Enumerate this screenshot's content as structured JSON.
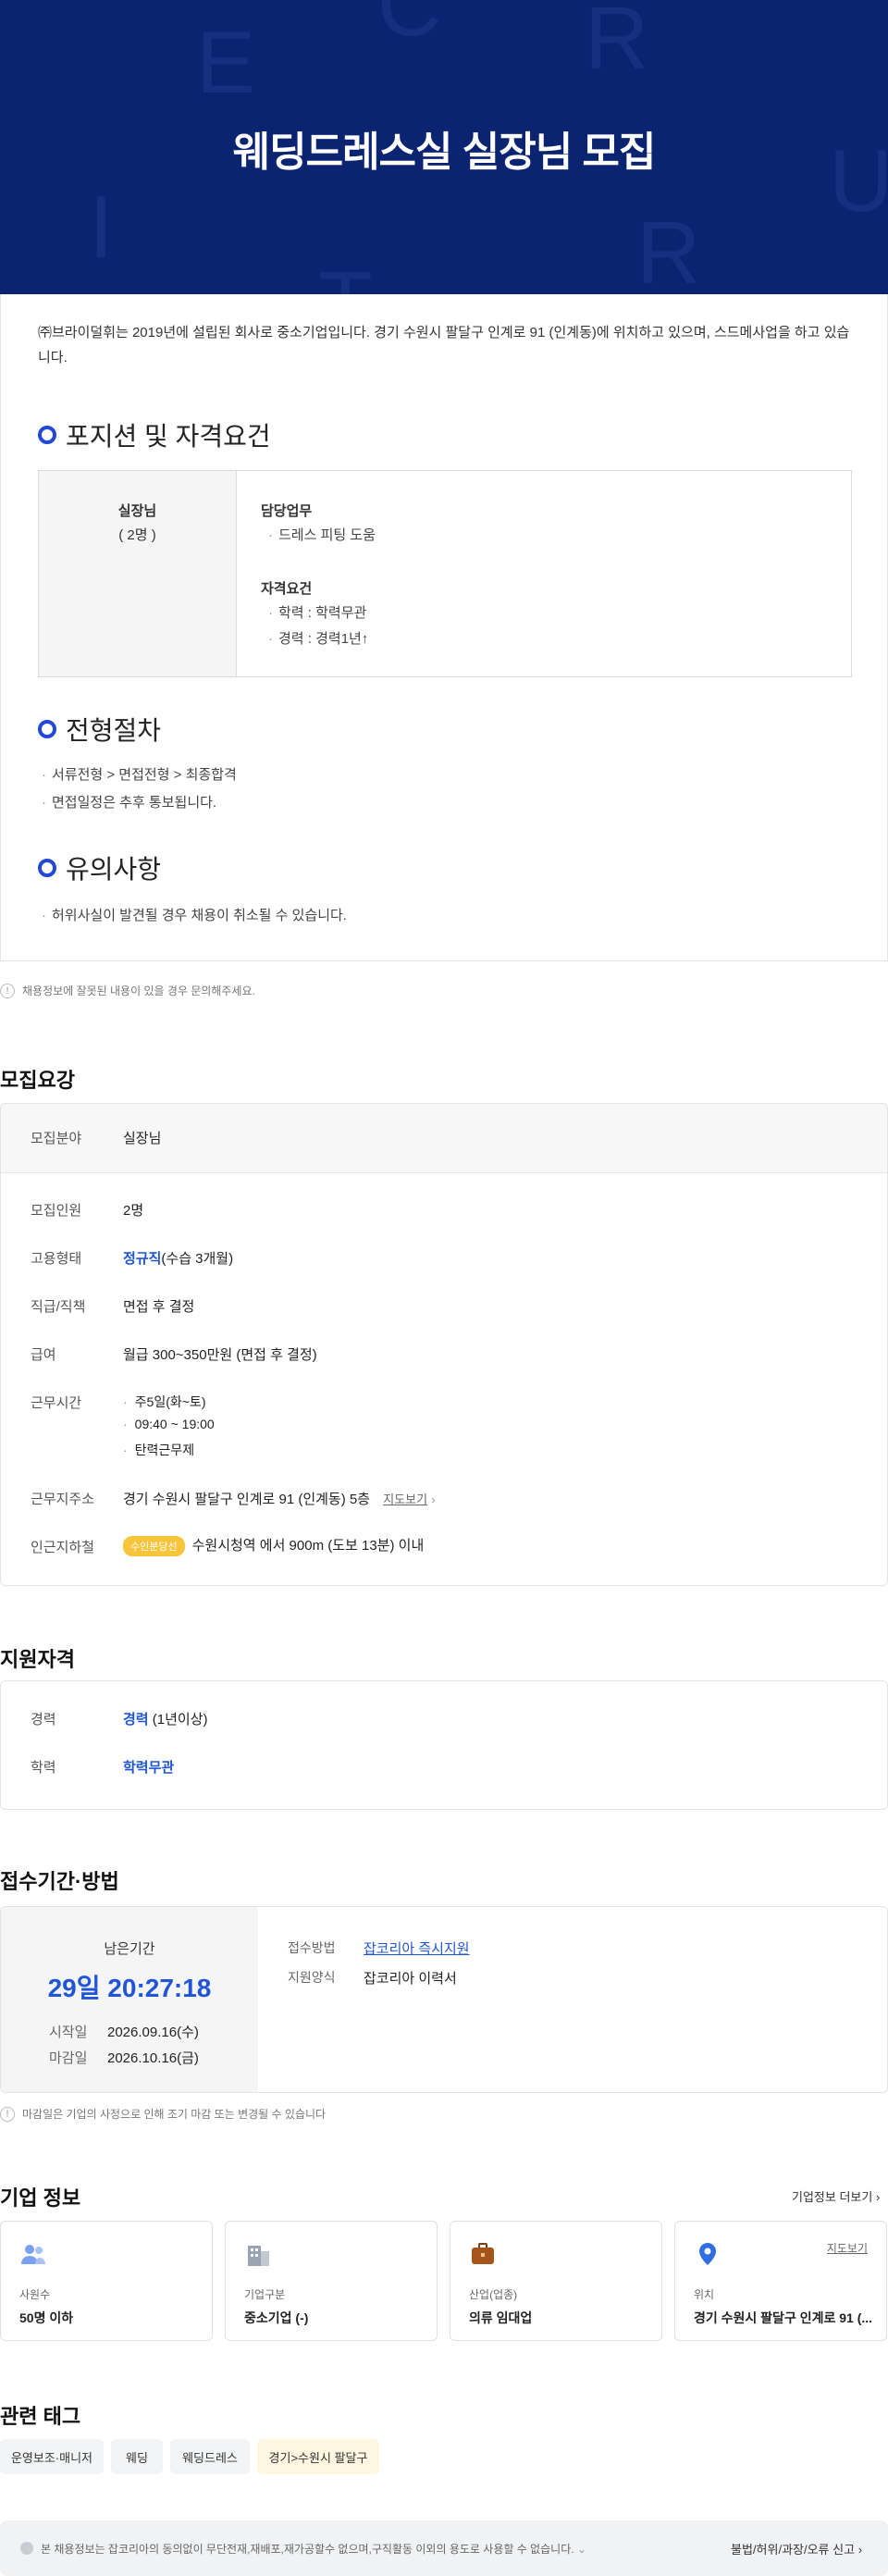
{
  "banner": {
    "title": "웨딩드레스실 실장님 모집",
    "letters": [
      "E",
      "R",
      "C",
      "U",
      "I",
      "T",
      "R"
    ]
  },
  "intro": "㈜브라이덜휘는 2019년에 설립된 회사로 중소기업입니다. 경기 수원시 팔달구 인계로 91 (인계동)에 위치하고 있으며, 스드메사업을 하고 있습니다.",
  "position_section": {
    "title": "포지션 및 자격요건",
    "role": "실장님",
    "count": "( 2명 )",
    "duty_label": "담당업무",
    "duties": [
      "드레스 피팅 도움"
    ],
    "qual_label": "자격요건",
    "quals": [
      "학력 : 학력무관",
      "경력 : 경력1년↑"
    ]
  },
  "process_section": {
    "title": "전형절차",
    "lines": [
      "서류전형 > 면접전형 > 최종합격",
      "면접일정은 추후 통보됩니다."
    ]
  },
  "caution_section": {
    "title": "유의사항",
    "lines": [
      "허위사실이 발견될 경우 채용이 취소될 수 있습니다."
    ]
  },
  "notice_error": {
    "icon": "info-icon",
    "text": "채용정보에 잘못된 내용이 있을 경우 문의해주세요."
  },
  "requirements": {
    "title": "모집요강",
    "field_label": "모집분야",
    "field_value": "실장님",
    "headcount_label": "모집인원",
    "headcount_value": "2명",
    "employment_label": "고용형태",
    "employment_highlight": "정규직",
    "employment_rest": "(수습 3개월)",
    "rank_label": "직급/직책",
    "rank_value": "면접 후 결정",
    "salary_label": "급여",
    "salary_value": "월급 300~350만원 (면접 후 결정)",
    "hours_label": "근무시간",
    "hours_values": [
      "주5일(화~토)",
      "09:40 ~ 19:00",
      "탄력근무제"
    ],
    "address_label": "근무지주소",
    "address_value": "경기 수원시 팔달구 인계로 91 (인계동) 5층",
    "map_link": "지도보기",
    "subway_label": "인근지하철",
    "subway_badge": "수인분당선",
    "subway_value": "수원시청역 에서 900m (도보 13분) 이내"
  },
  "qualifications": {
    "title": "지원자격",
    "career_label": "경력",
    "career_highlight": "경력",
    "career_rest": " (1년이상)",
    "edu_label": "학력",
    "edu_value": "학력무관"
  },
  "application": {
    "title": "접수기간·방법",
    "remain_label": "남은기간",
    "remain_value": "29일 20:27:18",
    "start_label": "시작일",
    "start_value": "2026.09.16(수)",
    "end_label": "마감일",
    "end_value": "2026.10.16(금)",
    "method_label": "접수방법",
    "method_value": "잡코리아 즉시지원",
    "form_label": "지원양식",
    "form_value": "잡코리아 이력서",
    "note": "마감일은 기업의 사정으로 인해 조기 마감 또는 변경될 수 있습니다"
  },
  "company": {
    "title": "기업 정보",
    "more": "기업정보 더보기",
    "cards": [
      {
        "icon": "people-icon",
        "label": "사원수",
        "value": "50명 이하"
      },
      {
        "icon": "building-icon",
        "label": "기업구분",
        "value": "중소기업 (-)"
      },
      {
        "icon": "briefcase-icon",
        "label": "산업(업종)",
        "value": "의류 임대업"
      },
      {
        "icon": "map-pin-icon",
        "label": "위치",
        "value": "경기 수원시 팔달구 인계로 91 (...",
        "link": "지도보기"
      }
    ]
  },
  "tags": {
    "title": "관련 태그",
    "items": [
      "운영보조·매니저",
      "웨딩",
      "웨딩드레스",
      "경기>수원시 팔달구"
    ]
  },
  "footer": {
    "notice": "본 채용정보는 잡코리아의 동의없이 무단전재,재배포,재가공할수 없으며,구직활동 이외의 용도로 사용할 수 없습니다.",
    "report": "불법/허위/과장/오류 신고"
  },
  "colors": {
    "banner": "#0b2472",
    "accent_blue": "#1f55d6",
    "badge_yellow": "#f7c53b",
    "tag_highlight": "#fdf6e0"
  }
}
